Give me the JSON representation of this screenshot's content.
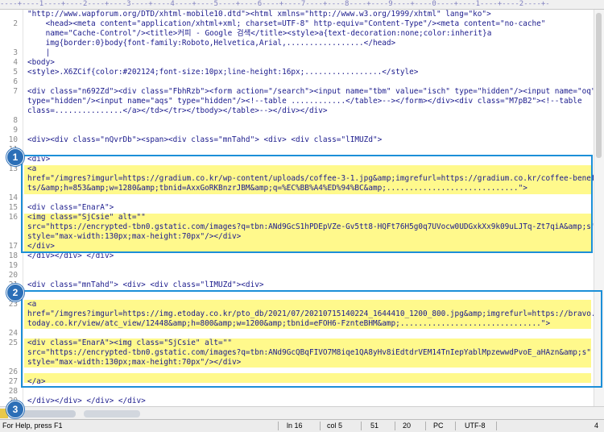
{
  "ruler": {
    "text": "----+----1----+----2----+----3----+----4----+----5----+----6----+----7----+----8----+----9----+----0----+----1----+----2----+-"
  },
  "lines": [
    {
      "n": "",
      "t": "\"http://www.wapforum.org/DTD/xhtml-mobile10.dtd\"><html xmlns=\"http://www.w3.org/1999/xhtml\" lang=\"ko\">"
    },
    {
      "n": "2",
      "t": "    <head><meta content=\"application/xhtml+xml; charset=UTF-8\" http-equiv=\"Content-Type\"/><meta content=\"no-cache\""
    },
    {
      "n": "",
      "t": "    name=\"Cache-Control\"/><title>커피 - Google 검색</title><style>a{text-decoration:none;color:inherit}a"
    },
    {
      "n": "",
      "t": "    img{border:0}body{font-family:Roboto,Helvetica,Arial,.................</head>"
    },
    {
      "n": "3",
      "t": "    |"
    },
    {
      "n": "4",
      "t": "<body>"
    },
    {
      "n": "5",
      "t": "<style>.X6ZCif{color:#202124;font-size:10px;line-height:16px;.................</style>"
    },
    {
      "n": "6",
      "t": ""
    },
    {
      "n": "7",
      "t": "<div class=\"n692Zd\"><div class=\"FbhRzb\"><form action=\"/search\"><input name=\"tbm\" value=\"isch\" type=\"hidden\"/><input name=\"oq\""
    },
    {
      "n": "",
      "t": "type=\"hidden\"/><input name=\"aqs\" type=\"hidden\"/><!--table ............</table>--></form></div><div class=\"M7pB2\"><!--table"
    },
    {
      "n": "",
      "t": "class=...............</a></td></tr></tbody></table>--></div></div>"
    },
    {
      "n": "8",
      "t": ""
    },
    {
      "n": "9",
      "t": ""
    },
    {
      "n": "10",
      "t": "<div><div class=\"nQvrDb\"><span><div class=\"mnTahd\"> <div> <div class=\"lIMUZd\">"
    },
    {
      "n": "11",
      "t": ""
    },
    {
      "n": "12",
      "t": "<div>"
    },
    {
      "n": "13",
      "t": "<a"
    },
    {
      "n": "",
      "t": "href=\"/imgres?imgurl=https://gradium.co.kr/wp-content/uploads/coffee-3-1.jpg&amp;imgrefurl=https://gradium.co.kr/coffee-benefi"
    },
    {
      "n": "",
      "t": "ts/&amp;h=853&amp;w=1280&amp;tbnid=AxxGoRKBnzrJBM&amp;q=%EC%BB%A4%ED%94%BC&amp;.............................\">"
    },
    {
      "n": "14",
      "t": ""
    },
    {
      "n": "15",
      "t": "<div class=\"EnarA\">"
    },
    {
      "n": "16",
      "t": "<img class=\"SjCsie\" alt=\"\""
    },
    {
      "n": "",
      "t": "src=\"https://encrypted-tbn0.gstatic.com/images?q=tbn:ANd9GcS1hPDEpVZe-Gv5tt8-HQFt76H5g0q7UVocw0UDGxkXx9k09uLJTq-Zt7qiA&amp;s\""
    },
    {
      "n": "",
      "t": "style=\"max-width:130px;max-height:70px\"/></div>"
    },
    {
      "n": "17",
      "t": "</div>"
    },
    {
      "n": "18",
      "t": "</div></div> </div>"
    },
    {
      "n": "19",
      "t": ""
    },
    {
      "n": "20",
      "t": ""
    },
    {
      "n": "21",
      "t": "<div class=\"mnTahd\"> <div> <div class=\"lIMUZd\"><div>"
    },
    {
      "n": "22",
      "t": ""
    },
    {
      "n": "23",
      "t": "<a"
    },
    {
      "n": "",
      "t": "href=\"/imgres?imgurl=https://img.etoday.co.kr/pto_db/2021/07/20210715140224_1644410_1200_800.jpg&amp;imgrefurl=https://bravo.e"
    },
    {
      "n": "",
      "t": "today.co.kr/view/atc_view/12448&amp;h=800&amp;w=1200&amp;tbnid=eFOH6-FznteBHM&amp;...............................\">"
    },
    {
      "n": "24",
      "t": ""
    },
    {
      "n": "25",
      "t": "<div class=\"EnarA\"><img class=\"SjCsie\" alt=\"\""
    },
    {
      "n": "",
      "t": "src=\"https://encrypted-tbn0.gstatic.com/images?q=tbn:ANd9GcQBqFIVO7M8iqe1QA8yHv8iEdtdrVEM14TnIepYablMpzewwdPvoE_aHAzn&amp;s\""
    },
    {
      "n": "",
      "t": "style=\"max-width:130px;max-height:70px\"/></div>"
    },
    {
      "n": "26",
      "t": ""
    },
    {
      "n": "27",
      "t": "</a>"
    },
    {
      "n": "28",
      "t": ""
    },
    {
      "n": "29",
      "t": "</div></div> </div> </div>"
    }
  ],
  "badges": [
    "1",
    "2",
    "3"
  ],
  "status": {
    "help": "For Help, press F1",
    "line": "ln 16",
    "col": "col 5",
    "num1": "51",
    "num2": "20",
    "eol": "PC",
    "encoding": "UTF-8",
    "right": "4"
  }
}
